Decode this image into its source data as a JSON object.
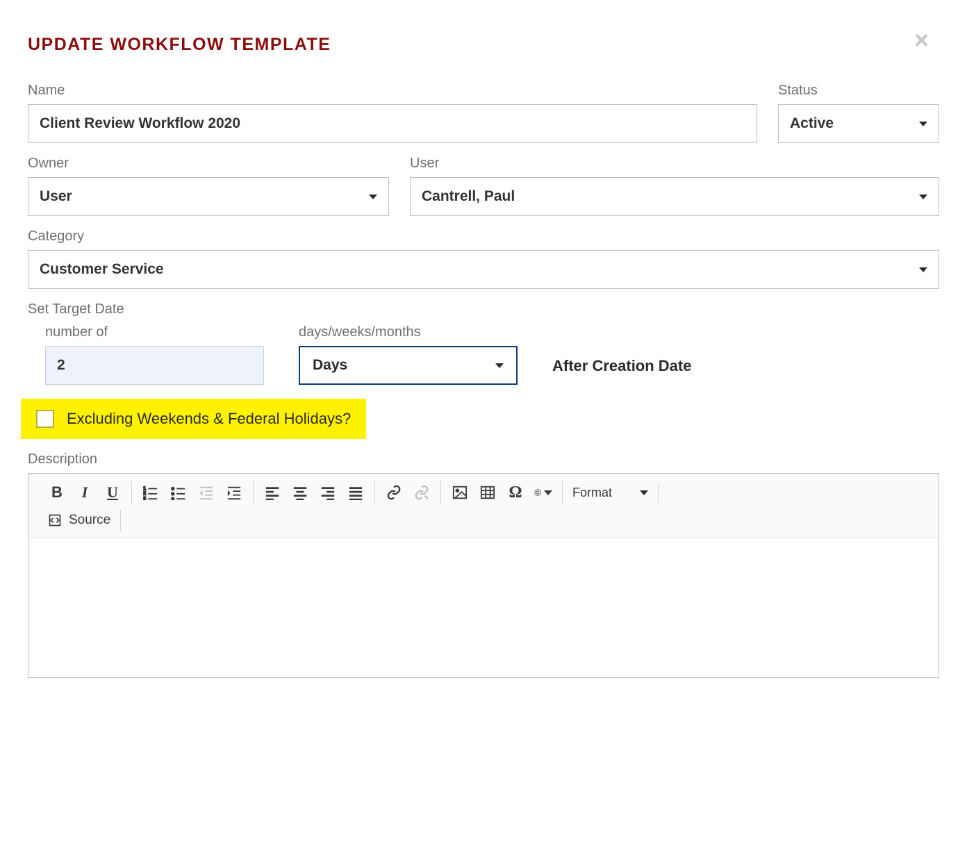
{
  "dialog": {
    "title": "UPDATE WORKFLOW TEMPLATE"
  },
  "fields": {
    "name": {
      "label": "Name",
      "value": "Client Review Workflow 2020"
    },
    "status": {
      "label": "Status",
      "value": "Active"
    },
    "owner": {
      "label": "Owner",
      "value": "User"
    },
    "user": {
      "label": "User",
      "value": "Cantrell, Paul"
    },
    "category": {
      "label": "Category",
      "value": "Customer Service"
    },
    "targetDate": {
      "label": "Set Target Date",
      "numberLabel": "number of",
      "numberValue": "2",
      "unitLabel": "days/weeks/months",
      "unitValue": "Days",
      "afterText": "After Creation Date"
    },
    "excluding": {
      "label": "Excluding Weekends & Federal Holidays?"
    },
    "description": {
      "label": "Description"
    }
  },
  "toolbar": {
    "format": "Format",
    "source": "Source"
  }
}
